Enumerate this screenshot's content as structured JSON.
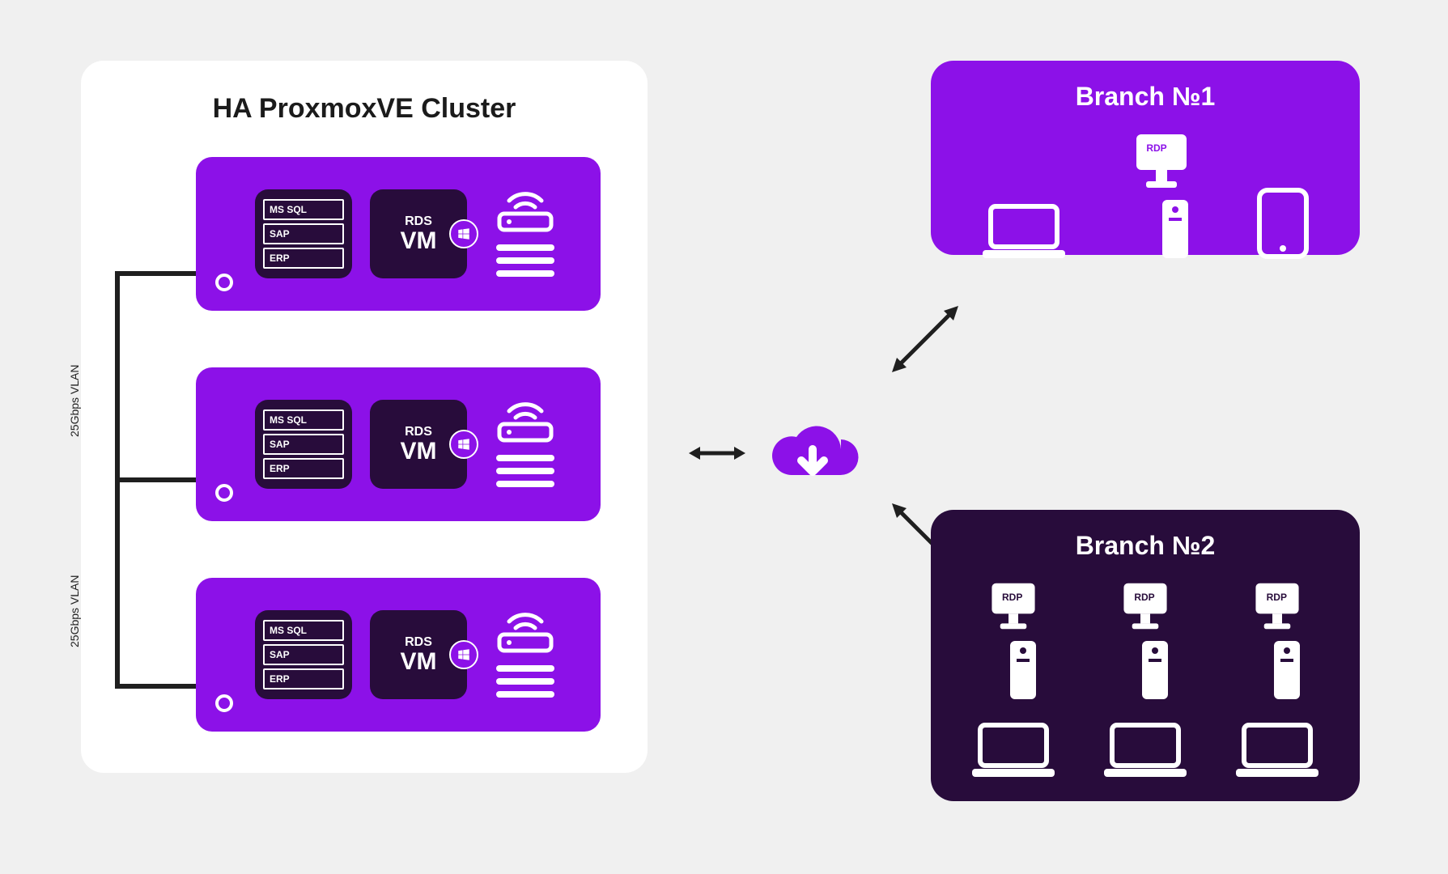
{
  "cluster": {
    "title": "HA ProxmoxVE Cluster",
    "vlan_label": "25Gbps VLAN",
    "node": {
      "db_labels": [
        "MS SQL",
        "SAP",
        "ERP"
      ],
      "vm": {
        "line1": "RDS",
        "line2": "VM",
        "os_icon": "windows-icon"
      }
    },
    "node_count": 3
  },
  "center": {
    "icon": "cloud-download-icon"
  },
  "branches": [
    {
      "title": "Branch №1",
      "bg": "#8c11e8",
      "devices_row1": [
        "laptop",
        "rdp-workstation",
        "tablet"
      ]
    },
    {
      "title": "Branch №2",
      "bg": "#280c3b",
      "devices_row1": [
        "rdp-workstation",
        "rdp-workstation",
        "rdp-workstation"
      ],
      "devices_row2": [
        "laptop",
        "laptop",
        "laptop"
      ]
    }
  ],
  "glossary": {
    "rdp_label": "RDP"
  },
  "colors": {
    "purple": "#8c11e8",
    "dark": "#280c3b",
    "grey_bg": "#f0f0f0"
  }
}
